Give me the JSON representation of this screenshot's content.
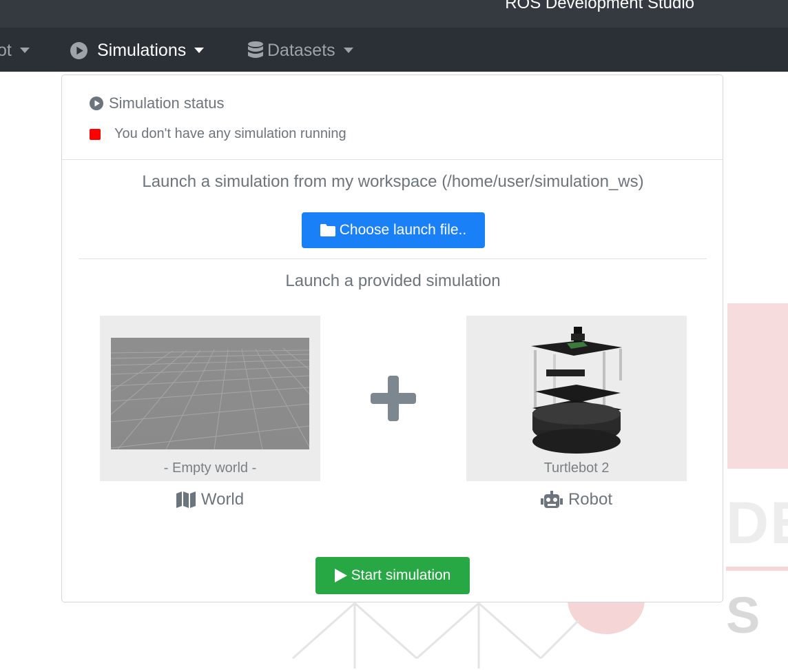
{
  "app": {
    "title": "ROS Development Studio"
  },
  "nav": {
    "items": [
      {
        "label": "ot",
        "icon": "caret-down-icon"
      },
      {
        "label": "Simulations",
        "icon": "play-circle-icon",
        "active": true
      },
      {
        "label": "Datasets",
        "icon": "database-icon"
      }
    ]
  },
  "panel": {
    "status_title": "Simulation status",
    "status_text": "You don't have any simulation running",
    "status_color": "#ff0000",
    "launch_workspace_text": "Launch a simulation from my workspace (/home/user/simulation_ws)",
    "choose_button_label": "Choose launch file..",
    "launch_provided_text": "Launch a provided simulation",
    "world_card_caption": "- Empty world -",
    "robot_card_caption": "Turtlebot 2",
    "world_label": "World",
    "robot_label": "Robot",
    "start_button_label": "Start simulation"
  },
  "colors": {
    "primary": "#1a80f7",
    "success": "#28a745",
    "navbar": "#2b2f36"
  },
  "watermark": {
    "letters": "DE",
    "s": "S"
  }
}
